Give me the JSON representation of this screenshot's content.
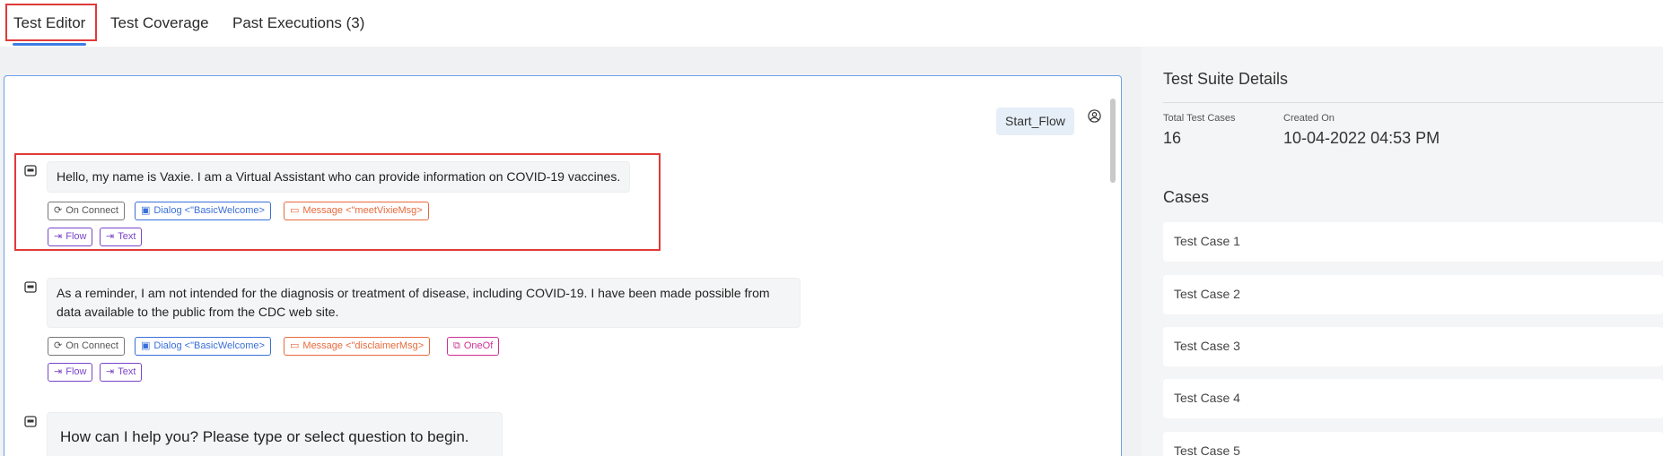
{
  "tabs": [
    {
      "label": "Test Editor",
      "active": true
    },
    {
      "label": "Test Coverage"
    },
    {
      "label": "Past Executions (3)"
    }
  ],
  "conversation": {
    "start_flow": "Start_Flow",
    "messages": [
      {
        "text": "Hello, my name is Vaxie. I am a Virtual Assistant who can provide information on COVID-19 vaccines.",
        "tags": [
          {
            "label": "On Connect",
            "icon": "refresh-icon"
          },
          {
            "label": "Dialog <\"BasicWelcome>",
            "icon": "dialog-icon"
          },
          {
            "label": "Message <\"meetVixieMsg>",
            "icon": "message-icon"
          },
          {
            "label": "Flow",
            "icon": "arrow-right-bar-icon"
          },
          {
            "label": "Text",
            "icon": "arrow-right-bar-icon"
          }
        ]
      },
      {
        "text_line1": "As a reminder, I am not intended for the diagnosis or treatment of disease, including COVID-19. I have been made possible from",
        "text_line2": "data available to the public from the CDC web site.",
        "tags": [
          {
            "label": "On Connect",
            "icon": "refresh-icon"
          },
          {
            "label": "Dialog <\"BasicWelcome>",
            "icon": "dialog-icon"
          },
          {
            "label": "Message <\"disclaimerMsg>",
            "icon": "message-icon"
          },
          {
            "label": "OneOf",
            "icon": "copy-icon"
          },
          {
            "label": "Flow",
            "icon": "arrow-right-bar-icon"
          },
          {
            "label": "Text",
            "icon": "arrow-right-bar-icon"
          }
        ]
      },
      {
        "text": "How can I help you? Please type or select question to begin."
      }
    ]
  },
  "suite": {
    "title": "Test Suite Details",
    "total_label": "Total Test Cases",
    "total_value": "16",
    "created_label": "Created On",
    "created_value": "10-04-2022 04:53 PM",
    "cases_title": "Cases",
    "cases": [
      "Test Case 1",
      "Test Case 2",
      "Test Case 3",
      "Test Case 4",
      "Test Case 5"
    ]
  },
  "colors": {
    "accent": "#3b7de0",
    "highlight": "#e03a3a",
    "tag_gray": "#555555",
    "tag_blue": "#3a6fd8",
    "tag_orange": "#e86a3c",
    "tag_purple": "#7a44c9",
    "tag_pink": "#cf2f93"
  }
}
